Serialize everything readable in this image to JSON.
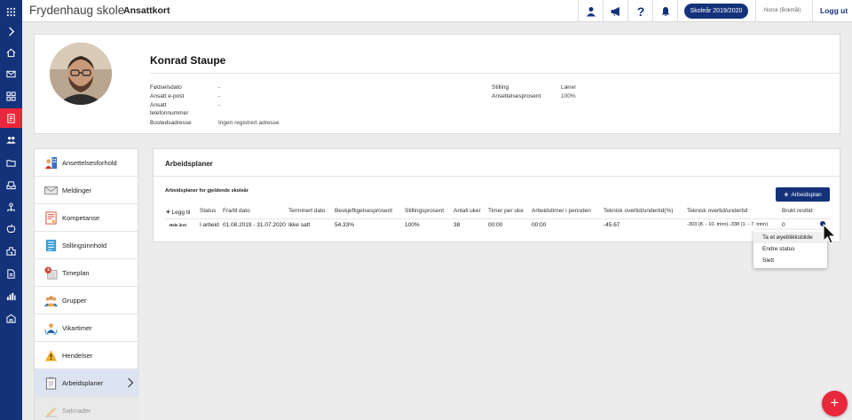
{
  "header": {
    "school_name": "Frydenhaug skole",
    "page_title": "Ansattkort",
    "school_year": "Skoleår 2019/2020",
    "language": "Norsk (Bokmål)",
    "logout": "Logg ut",
    "icons": [
      "user-icon",
      "megaphone-icon",
      "help-icon",
      "bell-icon"
    ]
  },
  "rail": {
    "icons": [
      "grid-icon",
      "expand-chevron-icon",
      "home-icon",
      "mail-icon",
      "modules-icon",
      "employee-card-icon",
      "people-icon",
      "folder-icon",
      "inbox-icon",
      "network-icon",
      "apple-icon",
      "building-icon",
      "document-icon",
      "chart-icon",
      "school-icon"
    ],
    "active_index": 5,
    "active_color": "#e8283a",
    "bg_color": "#14327a"
  },
  "profile": {
    "name": "Konrad Staupe",
    "fields_left": [
      {
        "label": "Fødselsdato",
        "value": "-"
      },
      {
        "label": "Ansatt e-post",
        "value": "-"
      },
      {
        "label": "Ansatt telefonnummer",
        "value": "-"
      },
      {
        "label": "Bostedsadresse",
        "value": "Ingen registrert adresse"
      }
    ],
    "fields_right": [
      {
        "label": "Stilling",
        "value": "Lærer"
      },
      {
        "label": "Ansettelsesprosent",
        "value": "100%"
      }
    ]
  },
  "menu": {
    "items": [
      {
        "label": "Ansettelsesforhold",
        "icon": "org-chart-icon"
      },
      {
        "label": "Meldinger",
        "icon": "envelope-icon"
      },
      {
        "label": "Kompetanse",
        "icon": "certificate-icon"
      },
      {
        "label": "Stillingsinnhold",
        "icon": "list-document-icon"
      },
      {
        "label": "Timeplan",
        "icon": "clock-calendar-icon"
      },
      {
        "label": "Grupper",
        "icon": "group-icon"
      },
      {
        "label": "Vikartimer",
        "icon": "substitute-icon"
      },
      {
        "label": "Hendelser",
        "icon": "warning-icon"
      },
      {
        "label": "Arbeidsplaner",
        "icon": "clipboard-icon"
      },
      {
        "label": "Søknader",
        "icon": "pencil-icon"
      }
    ],
    "active_index": 8,
    "disabled_index": 9
  },
  "main": {
    "title": "Arbeidsplaner",
    "subtitle": "Arbeidsplaner for gjeldende skoleår",
    "add_button": "Arbeidsplan",
    "add_row_label": "Legg til",
    "columns": [
      "Status",
      "Fra/til dato",
      "Terminert dato",
      "Beskjeftigelsesprosent",
      "Stillingsprosent",
      "Antall uker",
      "Timer per uke",
      "Arbeidstimer i perioden",
      "Teknisk overtid/undertid(%)",
      "Teknisk overtid/undertid",
      "Brukt resttid"
    ],
    "rows": [
      {
        "name": "Hele året",
        "cells": [
          "I arbeid",
          "01.08.2019 - 31.07.2020",
          "Ikke satt",
          "54.33%",
          "100%",
          "38",
          "00:00",
          "00:00",
          "-45.67",
          "-303 (8. - 10. trinn),-338 (1. - 7. trinn)",
          "0"
        ]
      }
    ]
  },
  "context_menu": {
    "items": [
      "Ta et øyeblikksbilde",
      "Endre status",
      "Slett"
    ],
    "hover_index": 0
  },
  "fab": {
    "label": "+"
  }
}
